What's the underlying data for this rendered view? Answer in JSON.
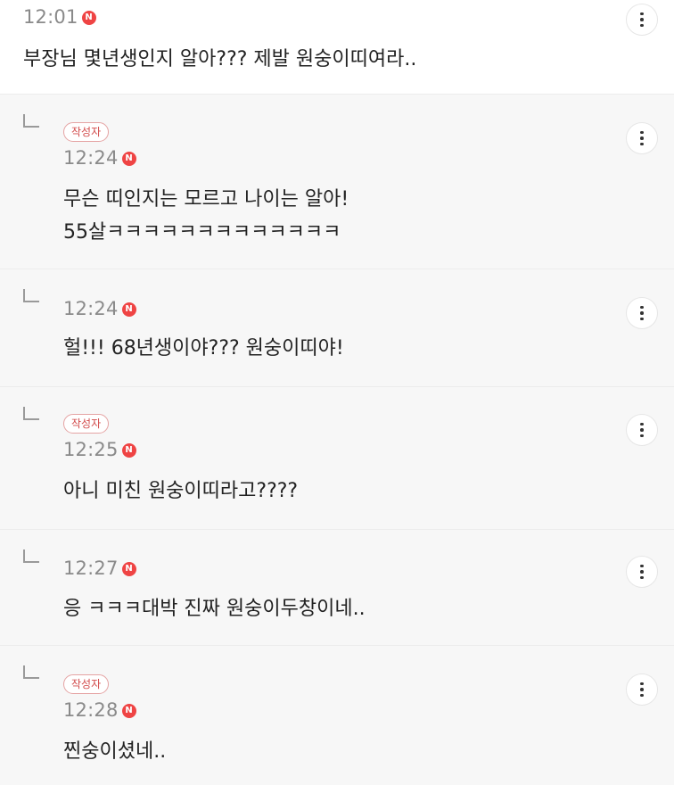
{
  "author_badge_label": "작성자",
  "new_badge_label": "N",
  "comments": [
    {
      "time": "12:01",
      "text": "부장님 몇년생인지 알아??? 제발 원숭이띠여라.."
    },
    {
      "time": "12:24",
      "text": "무슨 띠인지는 모르고 나이는 알아!\n55살ㅋㅋㅋㅋㅋㅋㅋㅋㅋㅋㅋㅋㅋ"
    },
    {
      "time": "12:24",
      "text": "헐!!! 68년생이야??? 원숭이띠야!"
    },
    {
      "time": "12:25",
      "text": "아니 미친 원숭이띠라고????"
    },
    {
      "time": "12:27",
      "text": "응 ㅋㅋㅋ대박 진짜 원숭이두창이네.."
    },
    {
      "time": "12:28",
      "text": "찐숭이셨네.."
    }
  ],
  "colors": {
    "accent_red": "#ef4444",
    "badge_border": "#e5a3a3",
    "reply_background": "#f7f7f7"
  },
  "icons": {
    "reply": "reply-arrow-icon",
    "more": "more-vertical-icon",
    "new": "new-badge-icon"
  }
}
